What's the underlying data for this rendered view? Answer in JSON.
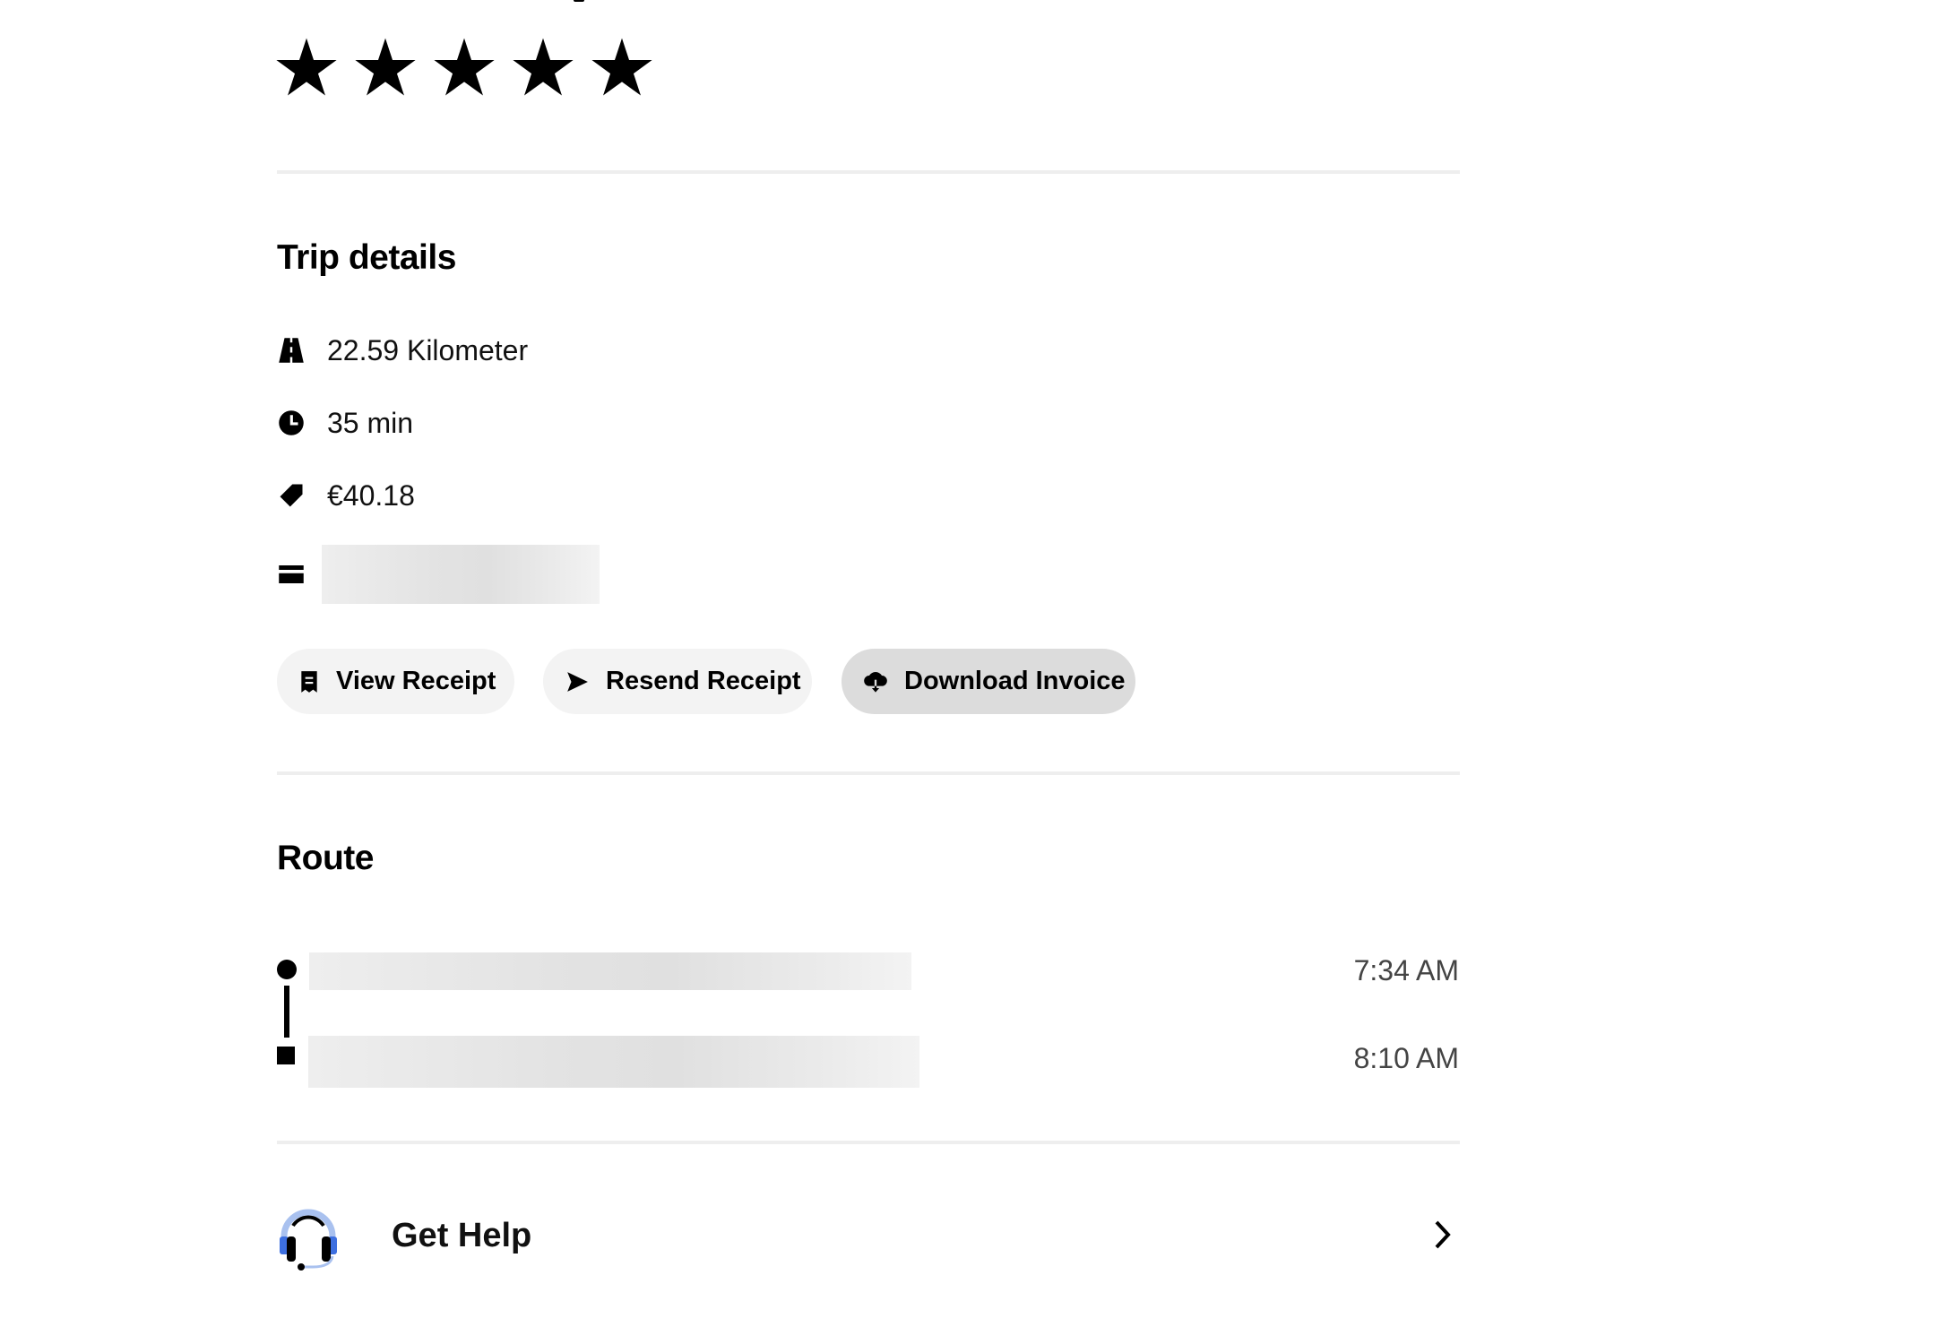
{
  "rating": {
    "stars_filled": 5,
    "stars_total": 5
  },
  "trip_details": {
    "title": "Trip details",
    "distance": "22.59 Kilometer",
    "duration": "35 min",
    "price": "€40.18",
    "payment_method": ""
  },
  "actions": {
    "view_receipt": "View Receipt",
    "resend_receipt": "Resend Receipt",
    "download_invoice": "Download Invoice"
  },
  "route": {
    "title": "Route",
    "stops": [
      {
        "address": "",
        "time": "7:34 AM"
      },
      {
        "address": "",
        "time": "8:10 AM"
      }
    ]
  },
  "help": {
    "label": "Get Help"
  },
  "colors": {
    "button_bg": "#f3f3f3",
    "button_active_bg": "#dcdcdc",
    "divider": "#eeeeee",
    "help_icon_accent": "#3d6fe0"
  }
}
